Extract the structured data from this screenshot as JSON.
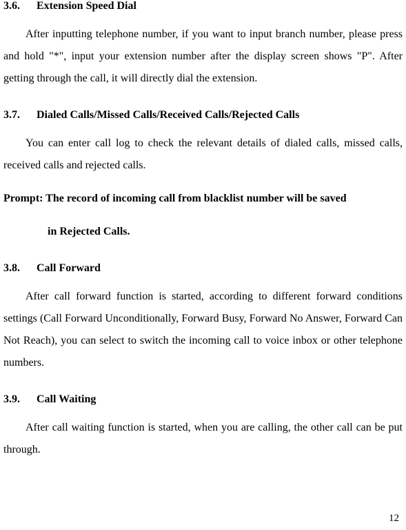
{
  "sections": {
    "s36": {
      "number": "3.6.",
      "title": "Extension Speed Dial",
      "body": "After inputting telephone number, if you want to input branch number, please press and hold \"*\", input your extension number after the display screen shows \"P\". After getting through the call, it will directly dial the extension."
    },
    "s37": {
      "number": "3.7.",
      "title": "Dialed Calls/Missed Calls/Received Calls/Rejected Calls",
      "body": "You can enter call log to check the relevant details of dialed calls, missed calls, received calls and rejected calls.",
      "prompt_line1": "Prompt: The record of incoming call from blacklist number will be saved",
      "prompt_line2": "in Rejected Calls."
    },
    "s38": {
      "number": "3.8.",
      "title": "Call Forward",
      "body": "After call forward function is started, according to different forward conditions settings (Call Forward Unconditionally, Forward Busy, Forward No Answer, Forward Can Not Reach), you can select to switch the incoming call to voice inbox or other telephone numbers."
    },
    "s39": {
      "number": "3.9.",
      "title": "Call Waiting",
      "body": "After call waiting function is started, when you are calling, the other call can be put through."
    }
  },
  "page_number": "12"
}
